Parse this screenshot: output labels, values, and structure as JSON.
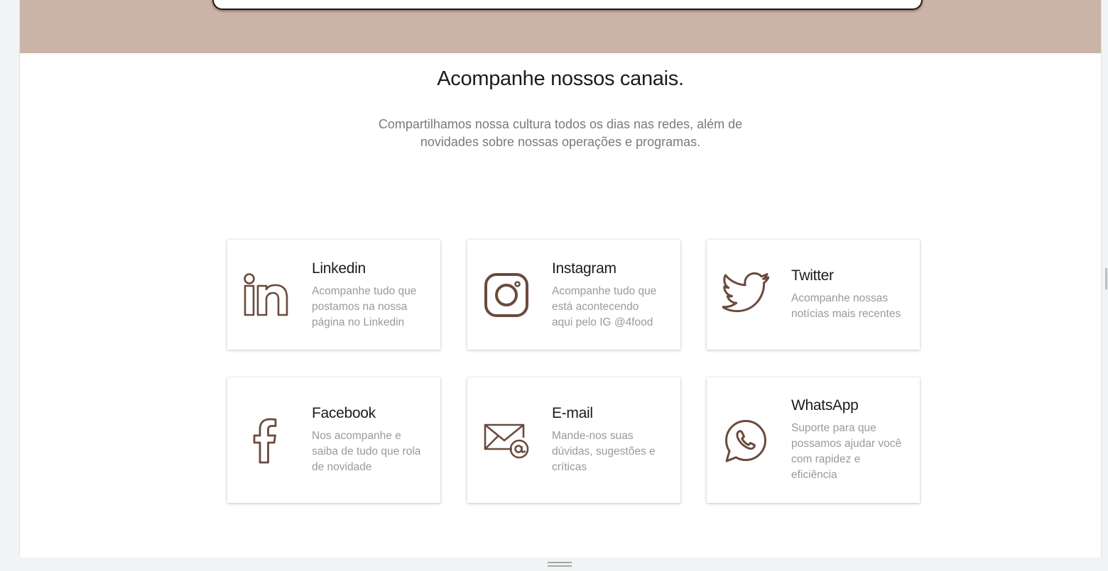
{
  "section": {
    "title": "Acompanhe nossos canais.",
    "subtitle_line1": "Compartilhamos nossa cultura todos os dias nas redes, além de",
    "subtitle_line2": "novidades sobre nossas operações e programas."
  },
  "colors": {
    "hero_band": "#cbb3a7",
    "icon_stroke": "#6b4a3c"
  },
  "channels": [
    {
      "icon": "linkedin-icon",
      "name": "Linkedin",
      "lines": [
        "Acompanhe tudo que",
        "postamos na nossa",
        "página no Linkedin"
      ]
    },
    {
      "icon": "instagram-icon",
      "name": "Instagram",
      "lines": [
        "Acompanhe tudo que",
        "está acontecendo",
        "aqui pelo IG @4food"
      ]
    },
    {
      "icon": "twitter-icon",
      "name": "Twitter",
      "lines": [
        "Acompanhe nossas",
        "notícias mais recentes"
      ]
    },
    {
      "icon": "facebook-icon",
      "name": "Facebook",
      "lines": [
        "Nos acompanhe e",
        "saiba de tudo que rola",
        "de novidade"
      ]
    },
    {
      "icon": "email-icon",
      "name": "E-mail",
      "lines": [
        "Mande-nos suas",
        "dúvidas, sugestões e",
        "críticas"
      ]
    },
    {
      "icon": "whatsapp-icon",
      "name": "WhatsApp",
      "lines": [
        "Suporte para que",
        "possamos ajudar você",
        "com rapidez e",
        "eficiência"
      ]
    }
  ]
}
